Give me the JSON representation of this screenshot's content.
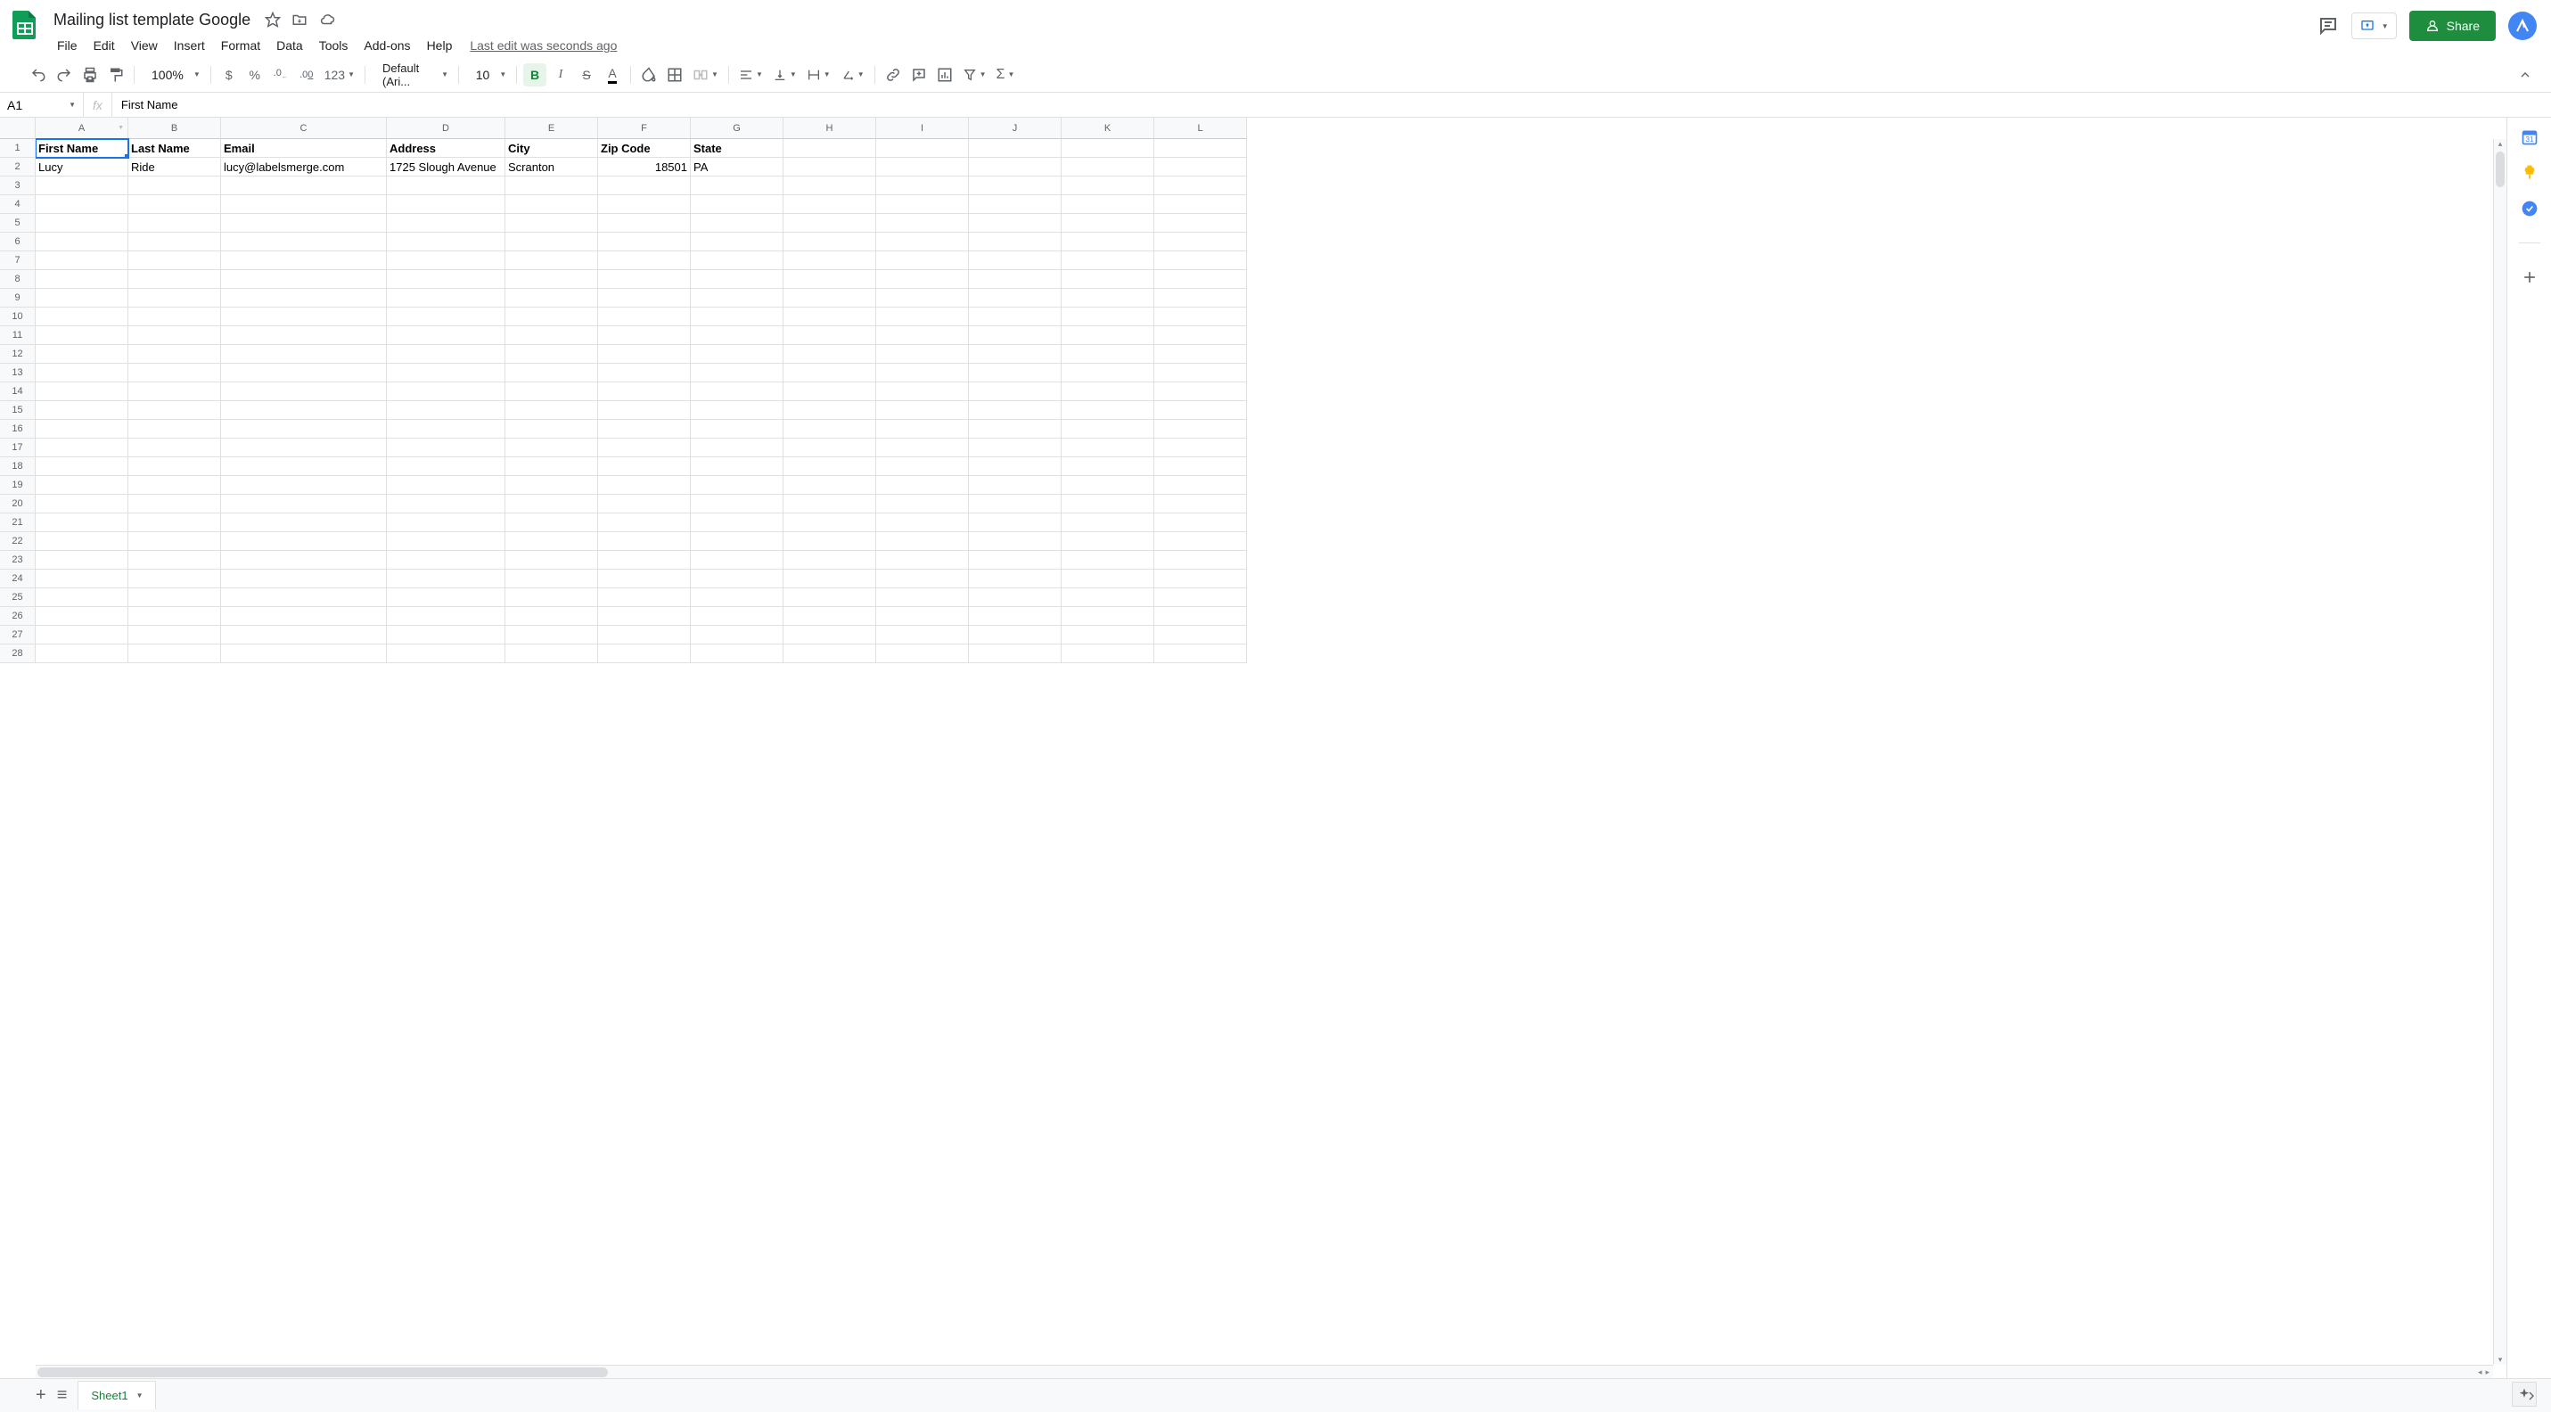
{
  "doc": {
    "title": "Mailing list template Google",
    "last_edit": "Last edit was seconds ago"
  },
  "menu": {
    "file": "File",
    "edit": "Edit",
    "view": "View",
    "insert": "Insert",
    "format": "Format",
    "data": "Data",
    "tools": "Tools",
    "addons": "Add-ons",
    "help": "Help"
  },
  "share": {
    "label": "Share"
  },
  "toolbar": {
    "zoom": "100%",
    "currency": "$",
    "percent": "%",
    "dec_dec": ".0",
    "inc_dec": ".00",
    "more_fmt": "123",
    "font": "Default (Ari...",
    "font_size": "10"
  },
  "formula_bar": {
    "cell_ref": "A1",
    "fx": "fx",
    "value": "First Name"
  },
  "columns": [
    "A",
    "B",
    "C",
    "D",
    "E",
    "F",
    "G",
    "H",
    "I",
    "J",
    "K",
    "L"
  ],
  "headers": {
    "A": "First Name",
    "B": "Last Name",
    "C": "Email",
    "D": "Address",
    "E": "City",
    "F": "Zip Code",
    "G": "State"
  },
  "rows": [
    {
      "A": "Lucy",
      "B": "Ride",
      "C": "lucy@labelsmerge.com",
      "D": "1725 Slough Avenue",
      "E": "Scranton",
      "F": "18501",
      "G": "PA"
    }
  ],
  "sheet": {
    "name": "Sheet1"
  },
  "row_count": 28,
  "selected_cell": "A1"
}
